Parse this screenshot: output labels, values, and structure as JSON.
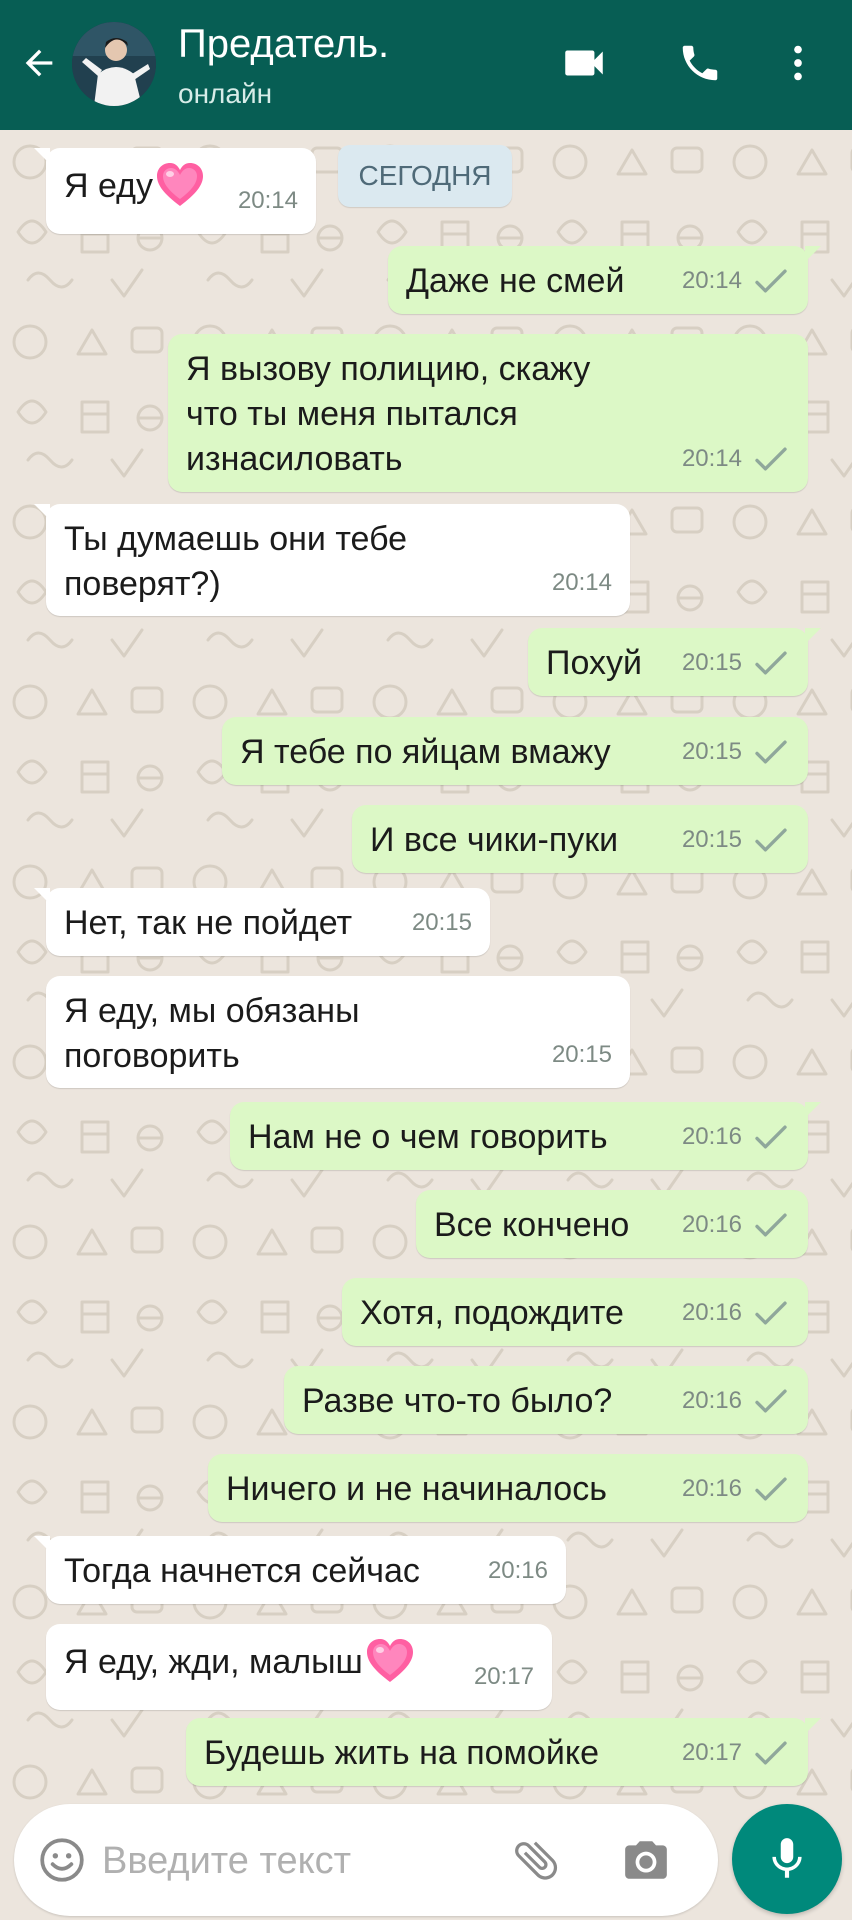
{
  "header": {
    "contact_name": "Предатель.",
    "status": "онлайн",
    "icons": [
      "back-arrow-icon",
      "video-call-icon",
      "phone-icon",
      "more-vert-icon"
    ]
  },
  "chat": {
    "date_label": "СЕГОДНЯ",
    "messages": [
      {
        "dir": "in",
        "text": "Я еду",
        "time": "20:14",
        "emoji": "pink-heart"
      },
      {
        "dir": "out",
        "text": "Даже не смей",
        "time": "20:14",
        "status": "sent"
      },
      {
        "dir": "out",
        "text": "Я вызову полицию, скажу\nчто ты меня пытался\nизнасиловать",
        "time": "20:14",
        "status": "sent"
      },
      {
        "dir": "in",
        "text": "Ты думаешь они тебе\nповерят?)",
        "time": "20:14"
      },
      {
        "dir": "out",
        "text": "Похуй",
        "time": "20:15",
        "status": "sent"
      },
      {
        "dir": "out",
        "text": "Я тебе по яйцам вмажу",
        "time": "20:15",
        "status": "sent"
      },
      {
        "dir": "out",
        "text": "И все чики-пуки",
        "time": "20:15",
        "status": "sent"
      },
      {
        "dir": "in",
        "text": "Нет, так не пойдет",
        "time": "20:15"
      },
      {
        "dir": "in",
        "text": "Я еду, мы обязаны\nпоговорить",
        "time": "20:15"
      },
      {
        "dir": "out",
        "text": "Нам не о чем говорить",
        "time": "20:16",
        "status": "sent"
      },
      {
        "dir": "out",
        "text": "Все кончено",
        "time": "20:16",
        "status": "sent"
      },
      {
        "dir": "out",
        "text": "Хотя, подождите",
        "time": "20:16",
        "status": "sent"
      },
      {
        "dir": "out",
        "text": "Разве что-то было?",
        "time": "20:16",
        "status": "sent"
      },
      {
        "dir": "out",
        "text": "Ничего и не начиналось",
        "time": "20:16",
        "status": "sent"
      },
      {
        "dir": "in",
        "text": "Тогда начнется сейчас",
        "time": "20:16"
      },
      {
        "dir": "in",
        "text": "Я еду, жди, малыш",
        "time": "20:17",
        "emoji": "pink-heart"
      },
      {
        "dir": "out",
        "text": "Будешь жить на помойке",
        "time": "20:17",
        "status": "sent"
      }
    ]
  },
  "composer": {
    "placeholder": "Введите текст",
    "icons": [
      "emoji-icon",
      "attach-icon",
      "camera-icon",
      "mic-icon"
    ]
  },
  "colors": {
    "header_bg": "#075e54",
    "chat_bg": "#ece5dd",
    "incoming_bg": "#ffffff",
    "outgoing_bg": "#dcf8c6",
    "date_chip_bg": "#dbe9f0",
    "mic_button_bg": "#00897b",
    "heart": "#ff5fa2"
  }
}
